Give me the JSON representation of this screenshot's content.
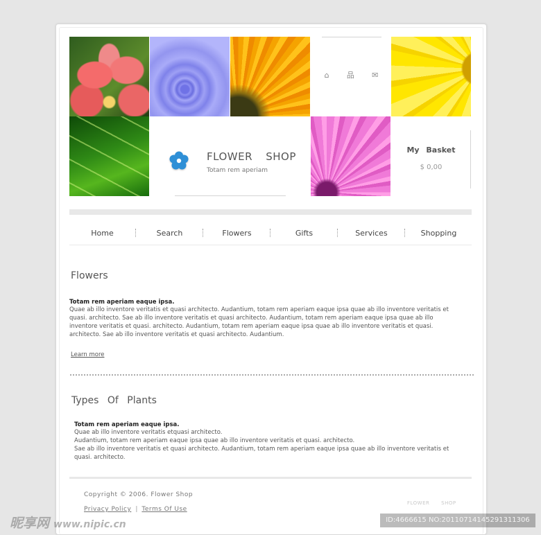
{
  "header": {
    "icons": [
      {
        "name": "home-icon",
        "glyph": "⌂"
      },
      {
        "name": "sitemap-icon",
        "glyph": "品"
      },
      {
        "name": "mail-icon",
        "glyph": "✉"
      }
    ],
    "brand_title": "FLOWER SHOP",
    "brand_sub": "Totam rem aperiam",
    "basket_title": "My Basket",
    "basket_amount": "$ 0,00"
  },
  "nav": {
    "items": [
      "Home",
      "Search",
      "Flowers",
      "Gifts",
      "Services",
      "Shopping"
    ]
  },
  "section1": {
    "title": "Flowers",
    "lead": "Totam rem aperiam eaque ipsa.",
    "lines": [
      "Quae ab illo inventore veritatis et quasi architecto. Audantium, totam rem aperiam eaque ipsa quae ab illo inventore veritatis et",
      "quasi. architecto. Sae ab illo inventore veritatis et quasi architecto. Audantium, totam rem aperiam eaque ipsa quae ab illo",
      "inventore veritatis et quasi. architecto. Audantium, totam rem aperiam eaque ipsa quae ab illo inventore veritatis et quasi.",
      "architecto. Sae ab illo inventore veritatis et quasi architecto. Audantium."
    ],
    "learn_more": "Learn more"
  },
  "section2": {
    "title": "Types Of Plants",
    "lead": "Totam rem aperiam eaque ipsa.",
    "lines": [
      "Quae ab illo inventore veritatis etquasi architecto.",
      "Audantium, totam rem aperiam eaque ipsa quae ab illo inventore veritatis et quasi. architecto.",
      "Sae ab illo inventore veritatis et quasi architecto. Audantium, totam rem aperiam eaque ipsa quae ab illo inventore veritatis et",
      "quasi. architecto."
    ]
  },
  "footer": {
    "copyright": "Copyright © 2006. Flower Shop",
    "privacy": "Privacy Policy",
    "separator": "|",
    "terms": "Terms Of Use",
    "brand": "FLOWER SHOP"
  },
  "watermark": {
    "left_text": "昵享网",
    "left_url": "www.nipic.cn",
    "right_text": "ID:4666615 NO:20110714145291311306"
  },
  "colors": {
    "logo_flower": "#2f8fd6",
    "page_bg": "#e6e6e6"
  }
}
